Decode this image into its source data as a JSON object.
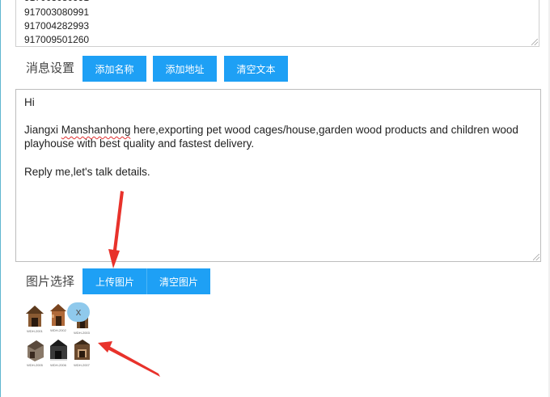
{
  "phone_list": {
    "lines": [
      "917004282993",
      "917009501260"
    ],
    "partial_lines": [
      "917003080991"
    ]
  },
  "message_settings": {
    "label": "消息设置",
    "buttons": {
      "add_name": "添加名称",
      "add_address": "添加地址",
      "clear_text": "清空文本"
    },
    "message_lines": [
      "Hi",
      "",
      "Jiangxi ",
      "playhouse with best quality and fastest delivery.",
      "",
      "Reply me,let's talk details."
    ],
    "message_line3_misspelled": "Manshanhong",
    "message_line3_rest": " here,exporting pet wood cages/house,garden wood products and children wood"
  },
  "image_select": {
    "label": "图片选择",
    "buttons": {
      "upload": "上传图片",
      "clear": "清空图片"
    },
    "remove_label": "x",
    "thumbnails": [
      {
        "caption": "WDH-2001",
        "icon": "dog-house-icon",
        "color": "#8a5a32"
      },
      {
        "caption": "WDH-2002",
        "icon": "dog-house-icon",
        "color": "#b06a3a"
      },
      {
        "caption": "WDH-2003",
        "icon": "dog-house-icon",
        "color": "#6e4a2a"
      },
      {
        "caption": "WDH-2005",
        "icon": "pet-house-icon",
        "color": "#7a6a5a"
      },
      {
        "caption": "WDH-2006",
        "icon": "pet-house-icon",
        "color": "#3a3a3a"
      },
      {
        "caption": "WDH-2007",
        "icon": "pet-house-icon",
        "color": "#6b4a2e"
      }
    ]
  },
  "colors": {
    "button_bg": "#1ea0f5",
    "annotation_arrow": "#e8322b"
  }
}
